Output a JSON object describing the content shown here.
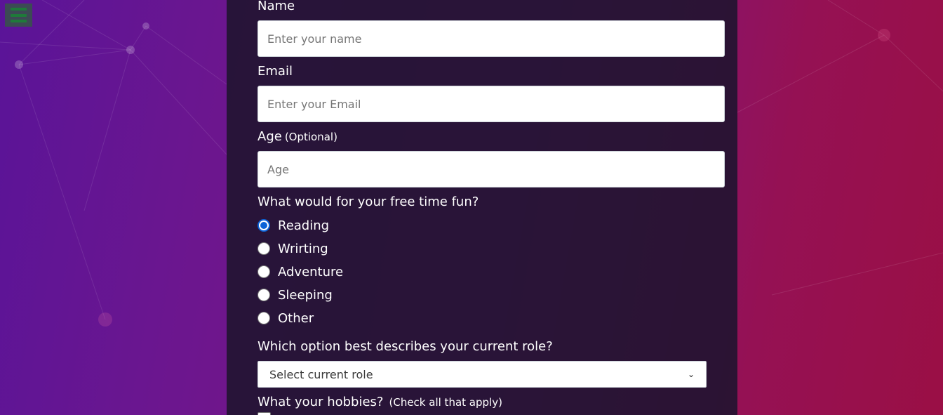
{
  "form": {
    "name": {
      "label": "Name",
      "placeholder": "Enter your name"
    },
    "email": {
      "label": "Email",
      "placeholder": "Enter your Email"
    },
    "age": {
      "label": "Age",
      "label_note": "(Optional)",
      "placeholder": "Age"
    },
    "free_time": {
      "question": "What would for your free time fun?",
      "options": [
        "Reading",
        "Wrirting",
        "Adventure",
        "Sleeping",
        "Other"
      ],
      "selected": "Reading"
    },
    "role": {
      "question": "Which option best describes your current role?",
      "selected_text": "Select current role"
    },
    "hobbies": {
      "question": "What your hobbies?",
      "note": "(Check all that apply)"
    }
  },
  "colors": {
    "radio_accent": "#0b63d8",
    "menu_button_bg": "#3c4a54",
    "menu_bars": "#1f7a3a"
  },
  "icons": {
    "menu": "hamburger-menu-icon",
    "select": "chevron-down-icon"
  }
}
